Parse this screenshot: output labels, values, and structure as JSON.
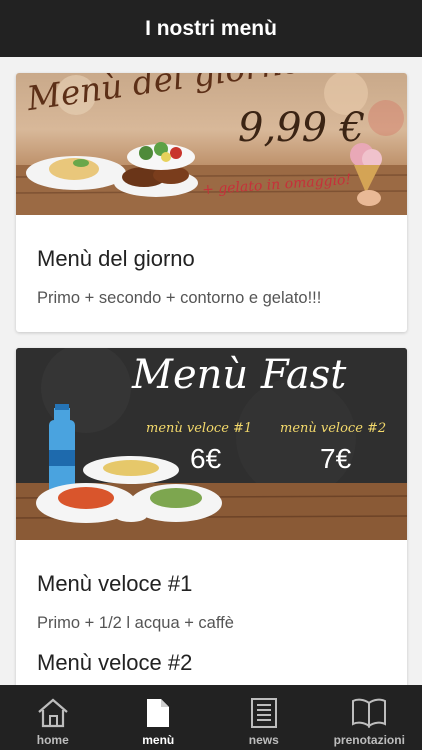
{
  "header": {
    "title": "I nostri menù"
  },
  "cards": [
    {
      "banner": {
        "script_title": "Menù del giorno",
        "price": "9,99 €",
        "note": "+ gelato in omaggio!"
      },
      "title": "Menù del giorno",
      "description": "Primo + secondo + contorno e gelato!!!"
    },
    {
      "banner": {
        "script_title": "Menù Fast",
        "option1_label": "menù veloce #1",
        "option1_price": "6€",
        "option2_label": "menù veloce #2",
        "option2_price": "7€"
      },
      "items": [
        {
          "title": "Menù veloce #1",
          "description": "Primo + 1/2 l acqua + caffè"
        },
        {
          "title": "Menù veloce #2"
        }
      ]
    }
  ],
  "tabbar": {
    "tabs": [
      {
        "label": "home",
        "icon": "home-icon",
        "active": false
      },
      {
        "label": "menù",
        "icon": "document-icon",
        "active": true
      },
      {
        "label": "news",
        "icon": "newspaper-icon",
        "active": false
      },
      {
        "label": "prenotazioni",
        "icon": "book-icon",
        "active": false
      }
    ]
  },
  "colors": {
    "bar": "#222222",
    "background": "#f2f2f2",
    "chalk_yellow": "#f3d96b"
  }
}
